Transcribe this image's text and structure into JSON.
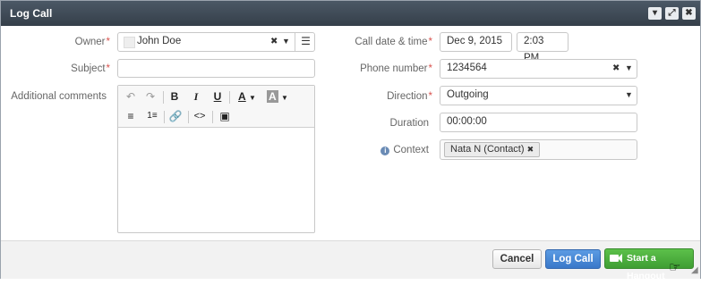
{
  "dialog": {
    "title": "Log Call"
  },
  "fields": {
    "owner": {
      "label": "Owner",
      "value": "John Doe"
    },
    "subject": {
      "label": "Subject",
      "value": ""
    },
    "comments": {
      "label": "Additional comments"
    },
    "call_datetime": {
      "label": "Call date & time",
      "date": "Dec 9, 2015",
      "time": "2:03 PM"
    },
    "phone": {
      "label": "Phone number",
      "value": "1234564"
    },
    "direction": {
      "label": "Direction",
      "value": "Outgoing"
    },
    "duration": {
      "label": "Duration",
      "value": "00:00:00"
    },
    "context": {
      "label": "Context",
      "chip": "Nata N (Contact)"
    }
  },
  "required_mark": "*",
  "footer": {
    "cancel": "Cancel",
    "log_call": "Log Call",
    "hangout": "Start a Hangout"
  },
  "colors": {
    "titlebar": "#3f4a56",
    "primary": "#4a88d6",
    "hangout": "#4caf3c",
    "required": "#d9534f"
  }
}
